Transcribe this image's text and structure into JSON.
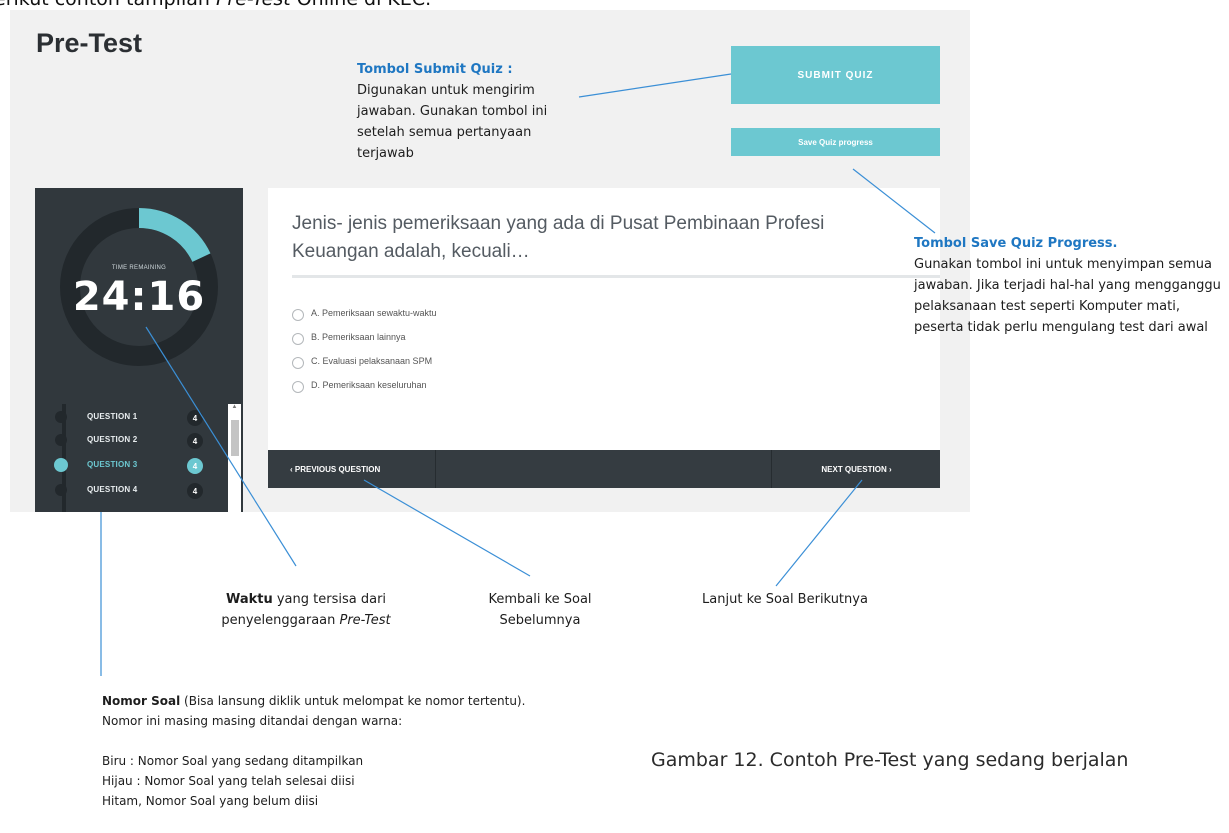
{
  "doc": {
    "intro_prefix": "erikut contoh tampilan ",
    "intro_italic": "Pre-Test",
    "intro_suffix": " Online di KEC.",
    "caption": "Gambar 12. Contoh Pre-Test yang sedang berjalan"
  },
  "page": {
    "title": "Pre-Test",
    "submit_label": "SUBMIT QUIZ",
    "save_label": "Save Quiz progress"
  },
  "timer": {
    "label": "TIME REMAINING",
    "value": "24:16",
    "remaining_fraction": 0.18
  },
  "questions": [
    {
      "label": "QUESTION 1",
      "badge": "4",
      "state": "answered"
    },
    {
      "label": "QUESTION 2",
      "badge": "4",
      "state": "unanswered"
    },
    {
      "label": "QUESTION 3",
      "badge": "4",
      "state": "current"
    },
    {
      "label": "QUESTION 4",
      "badge": "4",
      "state": "unanswered"
    }
  ],
  "quiz": {
    "question_text": "Jenis- jenis pemeriksaan yang ada di Pusat Pembinaan Profesi Keuangan adalah, kecuali…",
    "options": [
      "A. Pemeriksaan sewaktu-waktu",
      "B. Pemeriksaan lainnya",
      "C. Evaluasi pelaksanaan SPM",
      "D. Pemeriksaan keseluruhan"
    ],
    "prev_label": "‹ PREVIOUS QUESTION",
    "next_label": "NEXT QUESTION ›"
  },
  "annotations": {
    "submit_title": "Tombol Submit Quiz :",
    "submit_body": "Digunakan untuk mengirim jawaban. Gunakan tombol ini setelah semua pertanyaan terjawab",
    "save_title": "Tombol Save Quiz Progress",
    "save_body": "Gunakan tombol ini untuk menyimpan semua jawaban. Jika terjadi hal-hal yang mengganggu pelaksanaan test seperti Komputer mati, peserta tidak perlu mengulang test dari awal",
    "waktu_bold": "Waktu",
    "waktu_rest": " yang tersisa dari penyelenggaraan ",
    "waktu_italic": "Pre-Test",
    "kembali": "Kembali ke Soal Sebelumnya",
    "lanjut": "Lanjut ke Soal Berikutnya",
    "nomor_bold": "Nomor Soal",
    "nomor_rest": " (Bisa lansung diklik untuk melompat ke nomor tertentu).",
    "nomor_line2": "Nomor ini masing masing ditandai dengan warna:",
    "nomor_biru": "Biru : Nomor Soal yang sedang ditampilkan",
    "nomor_hijau": "Hijau : Nomor Soal yang telah selesai diisi",
    "nomor_hitam": "Hitam, Nomor Soal yang belum diisi"
  },
  "colors": {
    "accent": "#6cc8d1",
    "panel": "#31383d",
    "annotation_title": "#1f77c2",
    "leader_line": "#3b8fd6"
  }
}
